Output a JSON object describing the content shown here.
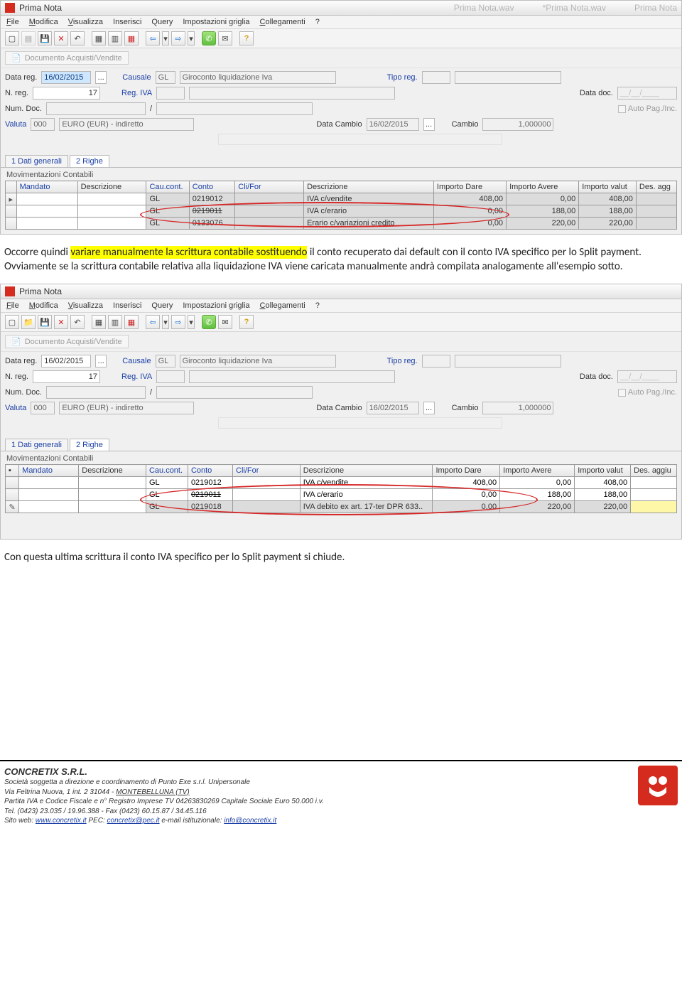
{
  "app": {
    "title": "Prima Nota",
    "ghost1": "Prima Nota.wav",
    "ghost2": "*Prima Nota.wav",
    "ghost3": "Prima Nota"
  },
  "menu": {
    "file": "File",
    "modifica": "Modifica",
    "visualizza": "Visualizza",
    "inserisci": "Inserisci",
    "query": "Query",
    "impostazioni": "Impostazioni griglia",
    "collegamenti": "Collegamenti",
    "help": "?"
  },
  "docbtn": "Documento Acquisti/Vendite",
  "form": {
    "datareg_lbl": "Data reg.",
    "datareg": "16/02/2015",
    "datareg_btn": "...",
    "causale_lbl": "Causale",
    "causale": "GL",
    "causale_desc": "Giroconto liquidazione Iva",
    "tiporeg_lbl": "Tipo reg.",
    "nreg_lbl": "N. reg.",
    "nreg": "17",
    "regiva_lbl": "Reg. IVA",
    "datadoc_lbl": "Data doc.",
    "datadoc": "__/__/____",
    "numdoc_lbl": "Num. Doc.",
    "numdoc_sep": "/",
    "autopag_lbl": "Auto Pag./Inc.",
    "valuta_lbl": "Valuta",
    "valuta_code": "000",
    "valuta_desc": "EURO (EUR)  - indiretto",
    "datacambio_lbl": "Data Cambio",
    "datacambio": "16/02/2015",
    "cambio_lbl": "Cambio",
    "cambio": "1,000000"
  },
  "tabs": {
    "t1": "1 Dati generali",
    "t2": "2 Righe"
  },
  "group": "Movimentazioni Contabili",
  "grid": {
    "headers": {
      "mandato": "Mandato",
      "descrizione_l": "Descrizione",
      "caucont": "Cau.cont.",
      "conto": "Conto",
      "clifor": "Cli/For",
      "descrizione": "Descrizione",
      "dare": "Importo Dare",
      "avere": "Importo Avere",
      "valut": "Importo valut",
      "desagg": "Des. agg"
    },
    "rows1": [
      {
        "cau": "GL",
        "conto": "0219012",
        "desc": "IVA c/vendite",
        "dare": "408,00",
        "avere": "0,00",
        "val": "408,00"
      },
      {
        "cau": "GL",
        "conto": "0219011",
        "strike": true,
        "desc": "IVA c/erario",
        "dare": "0,00",
        "avere": "188,00",
        "val": "188,00"
      },
      {
        "cau": "GL",
        "conto": "0133076",
        "desc": "Erario c/variazioni credito",
        "dare": "0,00",
        "avere": "220,00",
        "val": "220,00"
      }
    ],
    "rows2": [
      {
        "cau": "GL",
        "conto": "0219012",
        "desc": "IVA c/vendite",
        "dare": "408,00",
        "avere": "0,00",
        "val": "408,00"
      },
      {
        "cau": "GL",
        "conto": "0219011",
        "strike": true,
        "desc": "IVA c/erario",
        "dare": "0,00",
        "avere": "188,00",
        "val": "188,00"
      },
      {
        "cau": "GL",
        "conto": "0219018",
        "desc": "IVA debito ex art. 17-ter DPR 633..",
        "dare": "0,00",
        "avere": "220,00",
        "val": "220,00",
        "yellow": true
      }
    ],
    "desagg2": "Des. aggiu"
  },
  "para1_a": "Occorre quindi ",
  "para1_hl": "variare manualmente la scrittura contabile sostituendo",
  "para1_b": " il conto recuperato dai default con il conto IVA specifico per lo Split payment.",
  "para1_c": "Ovviamente se la scrittura contabile relativa alla liquidazione IVA viene caricata manualmente andrà compilata analogamente all'esempio sotto.",
  "para2": "Con questa ultima scrittura il conto IVA specifico per lo Split payment si chiude.",
  "footer": {
    "company": "CONCRETIX S.R.L.",
    "line1": "Società soggetta a direzione e coordinamento di Punto Exe s.r.l. Unipersonale",
    "line2a": "Via Feltrina Nuova, 1 int. 2   31044   -   ",
    "line2b": "MONTEBELLUNA (TV)",
    "line3": "Partita IVA e Codice Fiscale e n° Registro Imprese TV 04263830269      Capitale Sociale Euro 50.000 i.v.",
    "line4": "Tel. (0423) 23.035 / 19.96.388    -    Fax (0423) 60.15.87 / 34.45.116",
    "line5a": "Sito web:  ",
    "line5b": "www.concretix.it",
    "line5c": "        PEC: ",
    "line5d": "concretix@pec.it",
    "line5e": "        e-mail istituzionale: ",
    "line5f": "info@concretix.it"
  }
}
